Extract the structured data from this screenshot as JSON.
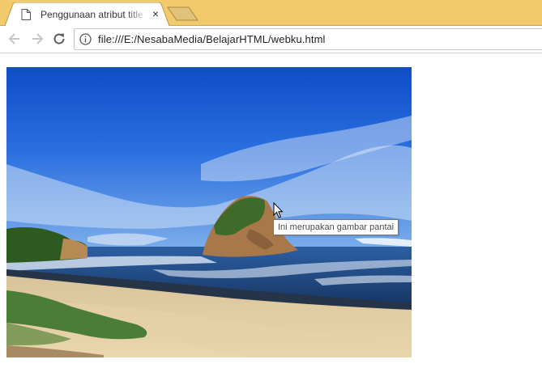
{
  "tab": {
    "title": "Penggunaan atribut title",
    "close_glyph": "×",
    "icon": "document-icon"
  },
  "toolbar": {
    "back_icon": "back-arrow-icon",
    "forward_icon": "forward-arrow-icon",
    "reload_icon": "reload-icon",
    "info_icon": "info-icon",
    "url": "file:///E:/NesabaMedia/BelajarHTML/webku.html"
  },
  "page": {
    "image_subject": "beach with rock island, sea and blue sky",
    "tooltip": "Ini merupakan gambar pantai"
  },
  "colors": {
    "tabstrip": "#f2c96b",
    "sky": "#1f5fd6",
    "sea": "#1d3f7a",
    "sand": "#e3cfa4"
  }
}
